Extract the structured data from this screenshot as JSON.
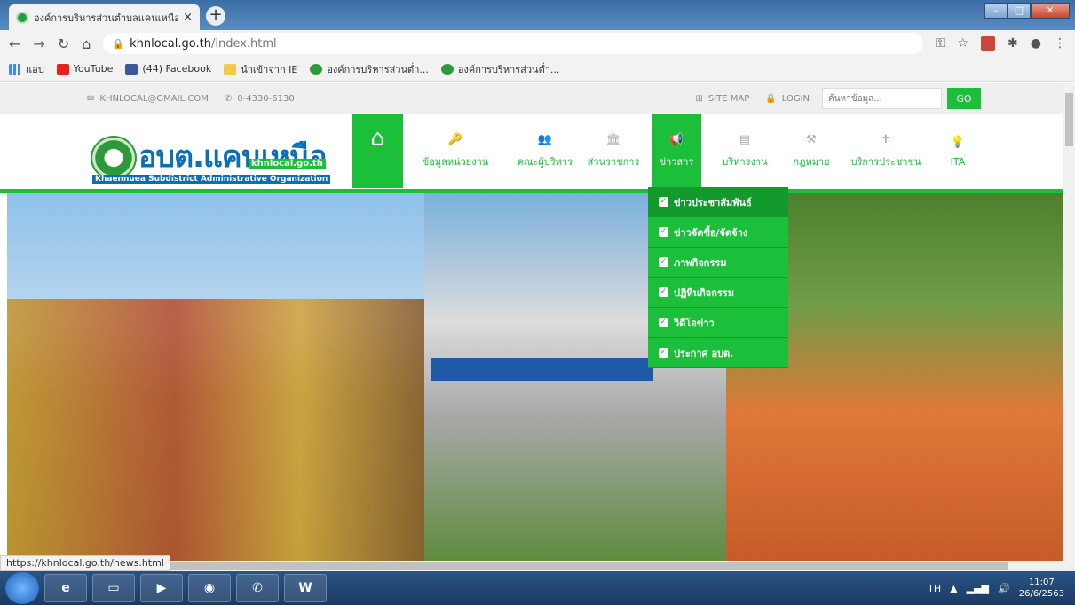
{
  "browser": {
    "tab_title": "องค์การบริหารส่วนตำบลแคนเหนือ",
    "tab_close": "×",
    "new_tab": "+",
    "url_host": "khnlocal.go.th",
    "url_path": "/index.html",
    "bookmarks": [
      {
        "label": "แอป",
        "icon": "apps-icon"
      },
      {
        "label": "YouTube",
        "icon": "youtube-icon"
      },
      {
        "label": "(44) Facebook",
        "icon": "facebook-icon"
      },
      {
        "label": "นำเข้าจาก IE",
        "icon": "folder-icon"
      },
      {
        "label": "องค์การบริหารส่วนต่ำ...",
        "icon": "org-icon"
      },
      {
        "label": "องค์การบริหารส่วนต่ำ...",
        "icon": "org-icon"
      }
    ],
    "status_url": "https://khnlocal.go.th/news.html"
  },
  "topbar": {
    "email": "KHNLOCAL@GMAIL.COM",
    "phone": "0-4330-6130",
    "sitemap": "SITE MAP",
    "login": "LOGIN",
    "search_placeholder": "ค้นหาข้อมูล...",
    "go": "GO"
  },
  "logo": {
    "thai": "อบต.แคนเหนือ",
    "site": "khnlocal.go.th",
    "english": "Khaennuea Subdistrict Administrative Organization"
  },
  "menu": [
    {
      "label": "ข้อมูลหน่วยงาน",
      "icon": "🔑"
    },
    {
      "label": "คณะผู้บริหาร",
      "icon": "👥"
    },
    {
      "label": "ส่วนราชการ",
      "icon": "🏛"
    },
    {
      "label": "ข่าวสาร",
      "icon": "📢"
    },
    {
      "label": "บริหารงาน",
      "icon": "▤"
    },
    {
      "label": "กฎหมาย",
      "icon": "⚒"
    },
    {
      "label": "บริการประชาชน",
      "icon": "✝"
    },
    {
      "label": "ITA",
      "icon": "💡"
    }
  ],
  "dropdown": [
    "ข่าวประชาสัมพันธ์",
    "ข่าวจัดซื้อ/จัดจ้าง",
    "ภาพกิจกรรม",
    "ปฏิทินกิจกรรม",
    "วิดีโอข่าว",
    "ประกาศ อบต."
  ],
  "hero": {
    "sign_text": "องค์การบริหารส่วนตำบลแคนเหนือ"
  },
  "taskbar": {
    "lang": "TH",
    "time": "11:07",
    "date": "26/6/2563"
  },
  "colors": {
    "accent": "#1bbf3a",
    "brand_blue": "#0b6fb8"
  }
}
